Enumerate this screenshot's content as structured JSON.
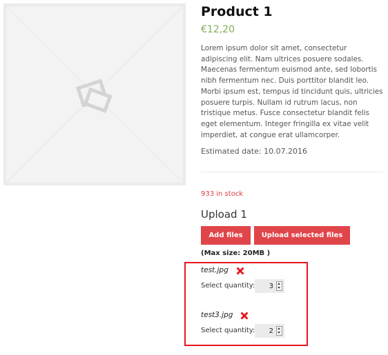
{
  "product": {
    "title": "Product 1",
    "price": "€12,20",
    "description": "Lorem ipsum dolor sit amet, consectetur adipiscing elit. Nam ultrices posuere sodales. Maecenas fermentum euismod ante, sed lobortis nibh fermentum nec. Duis porttitor blandit leo. Morbi ipsum est, tempus id tincidunt quis, ultricies posuere turpis. Nullam id rutrum lacus, non tristique metus. Fusce consectetur blandit felis eget elementum. Integer fringilla ex vitae velit imperdiet, at congue erat ullamcorper.",
    "estimated_date": "Estimated date: 10.07.2016",
    "stock": "933 in stock",
    "image_icon": "image-placeholder-icon"
  },
  "upload": {
    "title": "Upload 1",
    "add_files_label": "Add files",
    "upload_selected_label": "Upload selected files",
    "max_size": "(Max size: 20MB )",
    "files": [
      {
        "name": "test.jpg",
        "quantity_label": "Select quantity:",
        "quantity": "3"
      },
      {
        "name": "test3.jpg",
        "quantity_label": "Select quantity:",
        "quantity": "2"
      }
    ]
  },
  "colors": {
    "price": "#7fae57",
    "button": "#e0454a",
    "stock": "#e0393e",
    "highlight": "#e8141c",
    "remove_icon": "#e8141c"
  }
}
